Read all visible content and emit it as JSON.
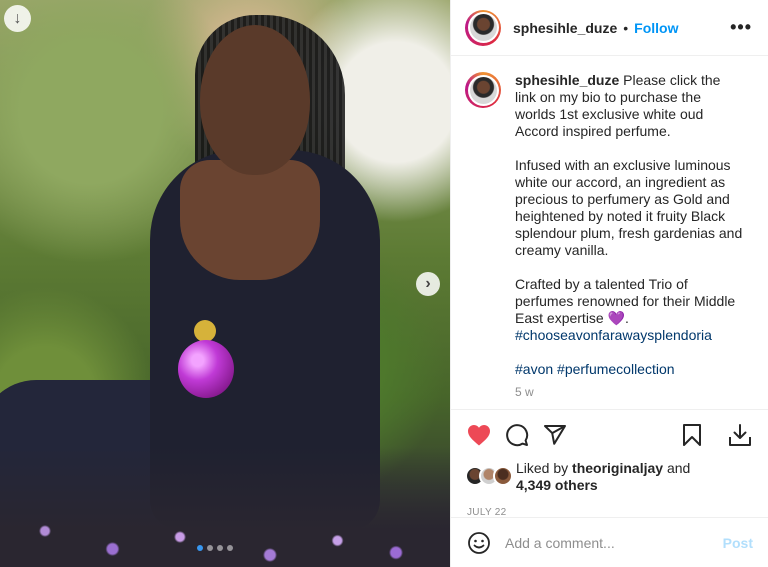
{
  "post": {
    "username": "sphesihle_duze",
    "follow_label": "Follow",
    "separator": "•",
    "more_label": "•••",
    "caption_paragraphs": [
      "Please click the link on my bio to purchase the worlds 1st exclusive white oud Accord inspired perfume.",
      "Infused with an exclusive luminous white our accord, an ingredient as precious to perfumery as Gold and heightened by noted it fruity Black splendour plum, fresh gardenias and creamy vanilla.",
      "Crafted by a talented Trio of perfumes renowned for their Middle East expertise 💜."
    ],
    "hashtag_line_1": "#chooseavonfarawaysplendoria",
    "hashtag_line_2": "#avon #perfumecollection",
    "timestamp": "5 w"
  },
  "likes": {
    "prefix": "Liked by",
    "user": "theoriginaljay",
    "and": "and",
    "others": "4,349 others"
  },
  "date": "JULY 22",
  "comment": {
    "placeholder": "Add a comment...",
    "post_label": "Post"
  },
  "carousel": {
    "slide_count": 4,
    "active_index": 0
  },
  "colors": {
    "heart": "#ed4956",
    "follow": "#0095f6",
    "post_disabled": "#b2dffc",
    "hashtag": "#00376b",
    "muted": "#8e8e8e",
    "active_dot": "#3897f0"
  },
  "icons": {
    "download": "download-icon",
    "next": "chevron-right-icon",
    "like": "heart-filled-icon",
    "comment": "comment-bubble-icon",
    "share": "paper-plane-icon",
    "save": "bookmark-icon",
    "download_action": "download-tray-icon",
    "emoji": "smiley-icon"
  }
}
